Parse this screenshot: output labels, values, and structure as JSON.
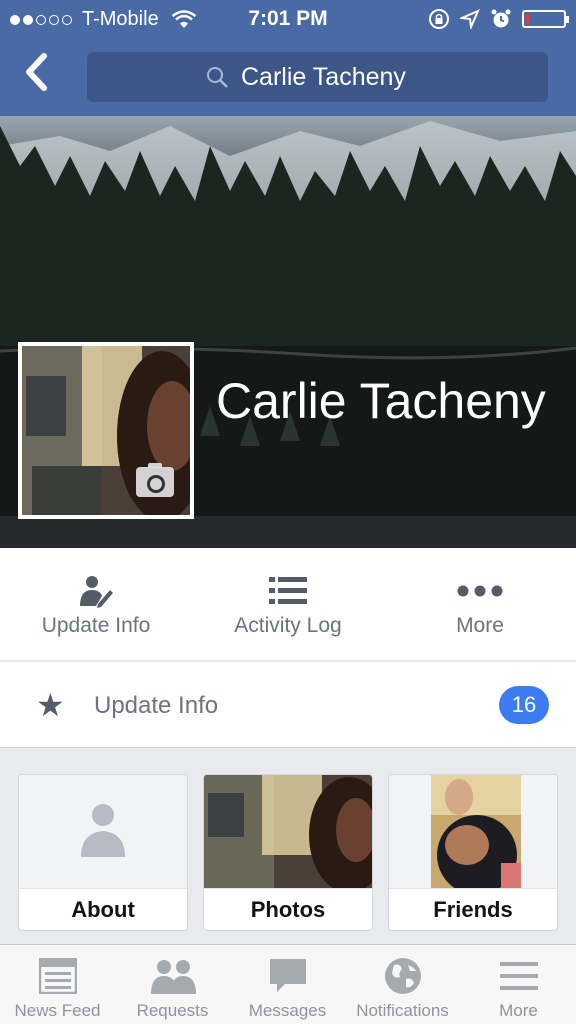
{
  "status_bar": {
    "carrier": "T-Mobile",
    "time": "7:01 PM"
  },
  "nav": {
    "back_icon": "chevron-left-icon",
    "search_query": "Carlie Tacheny"
  },
  "profile": {
    "name": "Carlie Tacheny"
  },
  "actions": [
    {
      "label": "Update Info",
      "icon": "edit-profile-icon"
    },
    {
      "label": "Activity Log",
      "icon": "list-icon"
    },
    {
      "label": "More",
      "icon": "more-dots-icon"
    }
  ],
  "update_row": {
    "label": "Update Info",
    "badge": "16",
    "icon": "star-icon"
  },
  "tiles": [
    {
      "label": "About"
    },
    {
      "label": "Photos"
    },
    {
      "label": "Friends"
    }
  ],
  "tabs": [
    {
      "label": "News Feed",
      "icon": "news-feed-icon"
    },
    {
      "label": "Requests",
      "icon": "friend-requests-icon"
    },
    {
      "label": "Messages",
      "icon": "messages-icon"
    },
    {
      "label": "Notifications",
      "icon": "globe-icon"
    },
    {
      "label": "More",
      "icon": "hamburger-icon"
    }
  ],
  "colors": {
    "nav_blue": "#4a6aa5",
    "search_blue": "#3b5687",
    "badge_blue": "#3c7cf0",
    "gray_text": "#6a7480"
  }
}
